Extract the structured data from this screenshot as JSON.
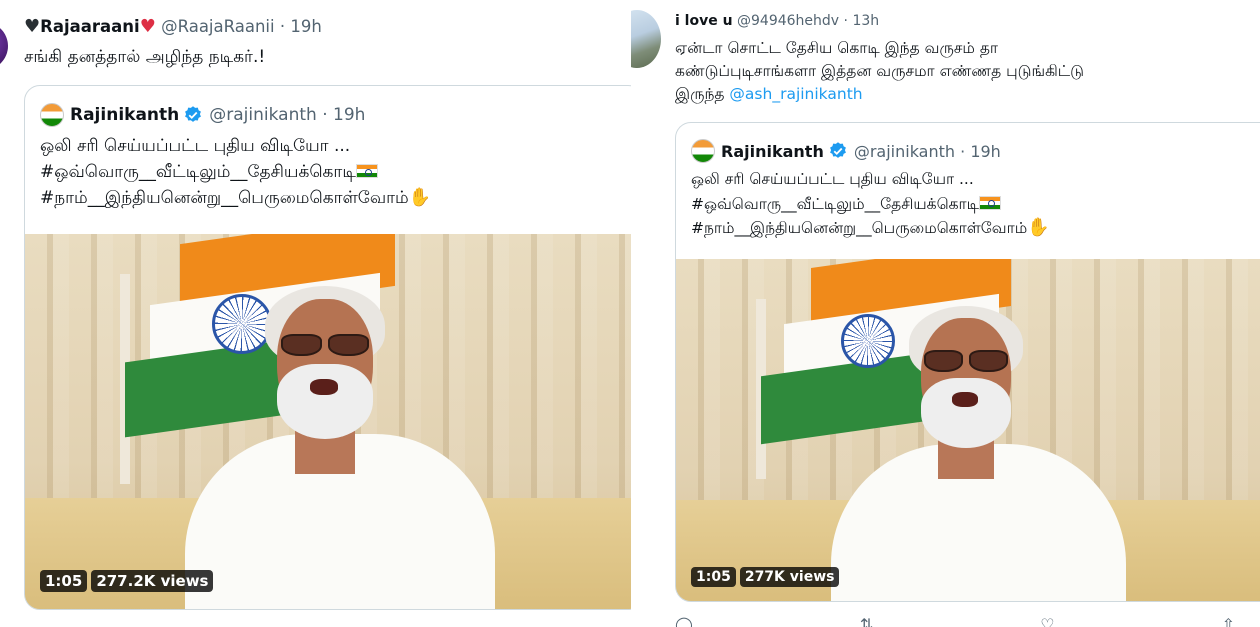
{
  "tweets": [
    {
      "author": {
        "name": "Rajaaraani",
        "handle": "@RaajaRaanii",
        "time": "19h",
        "prefix_emoji": "black-heart-icon",
        "suffix_emoji": "red-heart-icon"
      },
      "text": "சங்கி தனத்தால் அழிந்த நடிகர்.!",
      "quote": {
        "author": {
          "name": "Rajinikanth",
          "handle": "@rajinikanth",
          "time": "19h"
        },
        "lines": [
          "ஒலி சரி செய்யப்பட்ட புதிய விடியோ ...",
          "#ஒவ்வொரு__வீட்டிலும்__தேசியக்கொடி",
          "#நாம்__இந்தியனென்று__பெருமைகொள்வோம்"
        ],
        "video": {
          "duration": "1:05",
          "views": "277.2K views"
        }
      }
    },
    {
      "author": {
        "name": "i love u",
        "handle": "@94946hehdv",
        "time": "13h"
      },
      "text_lines": [
        "ஏன்டா சொட்ட தேசிய கொடி இந்த வருசம் தா",
        "கண்டுப்புடிசாங்களா இத்தன வருசமா எண்ணத புடுங்கிட்டு",
        "இருந்த"
      ],
      "mention": "@ash_rajinikanth",
      "quote": {
        "author": {
          "name": "Rajinikanth",
          "handle": "@rajinikanth",
          "time": "19h"
        },
        "lines": [
          "ஒலி சரி செய்யப்பட்ட புதிய விடியோ ...",
          "#ஒவ்வொரு__வீட்டிலும்__தேசியக்கொடி",
          "#நாம்__இந்தியனென்று__பெருமைகொள்வோம்"
        ],
        "video": {
          "duration": "1:05",
          "views": "277K views"
        }
      }
    }
  ],
  "ui": {
    "dot": "·",
    "accent_color": "#1d9bf0",
    "verified_color": "#1d9bf0"
  }
}
